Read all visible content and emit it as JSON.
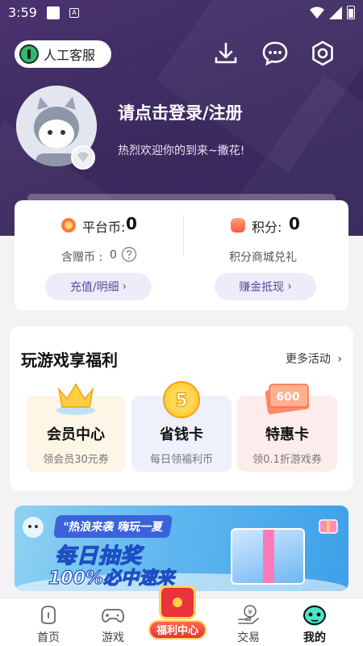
{
  "status_bar": {
    "time": "3:59"
  },
  "header": {
    "customer_service_label": "人工客服",
    "login_title": "请点击登录/注册",
    "welcome_text": "热烈欢迎你的到来~撒花!"
  },
  "wallet": {
    "platform_coin_label": "平台币:",
    "platform_coin_value": "0",
    "bonus_coin_label": "含赠币 :",
    "bonus_coin_value": "0",
    "points_label": "积分:",
    "points_value": "0",
    "points_sub": "积分商城兑礼",
    "recharge_button": "充值/明细",
    "earn_button": "赚金抵现"
  },
  "benefits": {
    "title": "玩游戏享福利",
    "more_label": "更多活动",
    "cards": [
      {
        "title": "会员中心",
        "subtitle": "领会员30元券",
        "bg": "#fdf5e6"
      },
      {
        "title": "省钱卡",
        "subtitle": "每日领福利币",
        "badge": "5",
        "bg": "#eef0fb"
      },
      {
        "title": "特惠卡",
        "subtitle": "领0.1折游戏券",
        "badge": "600",
        "bg": "#fdecec"
      }
    ]
  },
  "banner": {
    "tag": "\"热浪来袭 嗨玩一夏",
    "line1": "每日抽奖",
    "line2": "100%必中速来"
  },
  "nav": {
    "items": [
      {
        "label": "首页"
      },
      {
        "label": "游戏"
      },
      {
        "label": "福利中心"
      },
      {
        "label": "交易"
      },
      {
        "label": "我的"
      }
    ]
  },
  "colors": {
    "header_bg": "#3b2a5e",
    "accent": "#5b4aa0",
    "red": "#e8333a"
  }
}
